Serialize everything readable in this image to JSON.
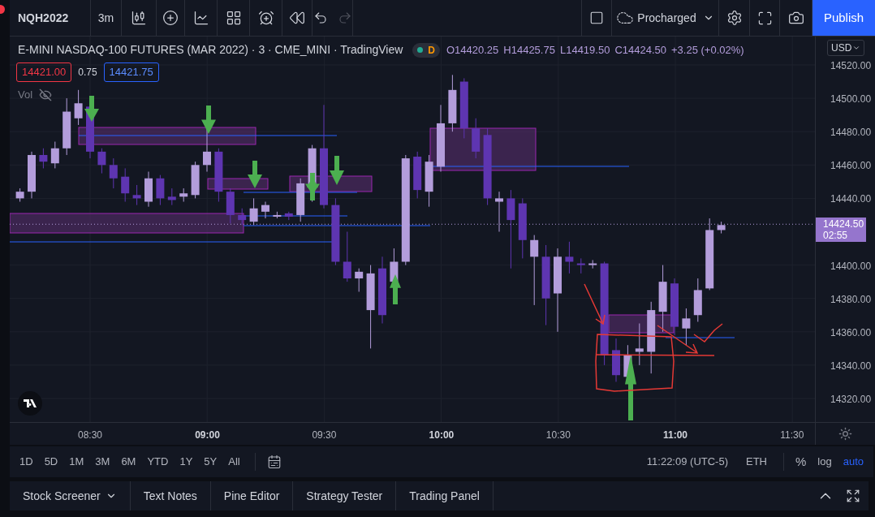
{
  "toolbar": {
    "symbol": "NQH2022",
    "interval": "3m",
    "layout": "Procharged",
    "publish": "Publish"
  },
  "legend": {
    "title": "E-MINI NASDAQ-100 FUTURES (MAR 2022) · 3 · CME_MINI · TradingView",
    "status_badge": "D",
    "open": "O14420.25",
    "high": "H14425.75",
    "low": "L14419.50",
    "close": "C14424.50",
    "change": "+3.25 (+0.02%)",
    "bid": "14421.00",
    "spread": "0.75",
    "ask": "14421.75",
    "volume_label": "Vol"
  },
  "price_axis": {
    "currency": "USD",
    "ticks": [
      "14520.00",
      "14500.00",
      "14480.00",
      "14460.00",
      "14440.00",
      "14400.00",
      "14380.00",
      "14360.00",
      "14340.00",
      "14320.00"
    ],
    "last_price": "14424.50",
    "countdown": "02:55"
  },
  "time_axis": [
    {
      "label": "08:30",
      "major": false
    },
    {
      "label": "09:00",
      "major": true
    },
    {
      "label": "09:30",
      "major": false
    },
    {
      "label": "10:00",
      "major": true
    },
    {
      "label": "10:30",
      "major": false
    },
    {
      "label": "11:00",
      "major": true
    },
    {
      "label": "11:30",
      "major": false
    }
  ],
  "ranges": [
    "1D",
    "5D",
    "1M",
    "3M",
    "6M",
    "YTD",
    "1Y",
    "5Y",
    "All"
  ],
  "status": {
    "clock": "11:22:09 (UTC-5)",
    "session": "ETH",
    "percent": "%",
    "log": "log",
    "auto": "auto",
    "auto_on": true
  },
  "panel_tabs": [
    "Stock Screener",
    "Text Notes",
    "Pine Editor",
    "Strategy Tester",
    "Trading Panel"
  ]
}
